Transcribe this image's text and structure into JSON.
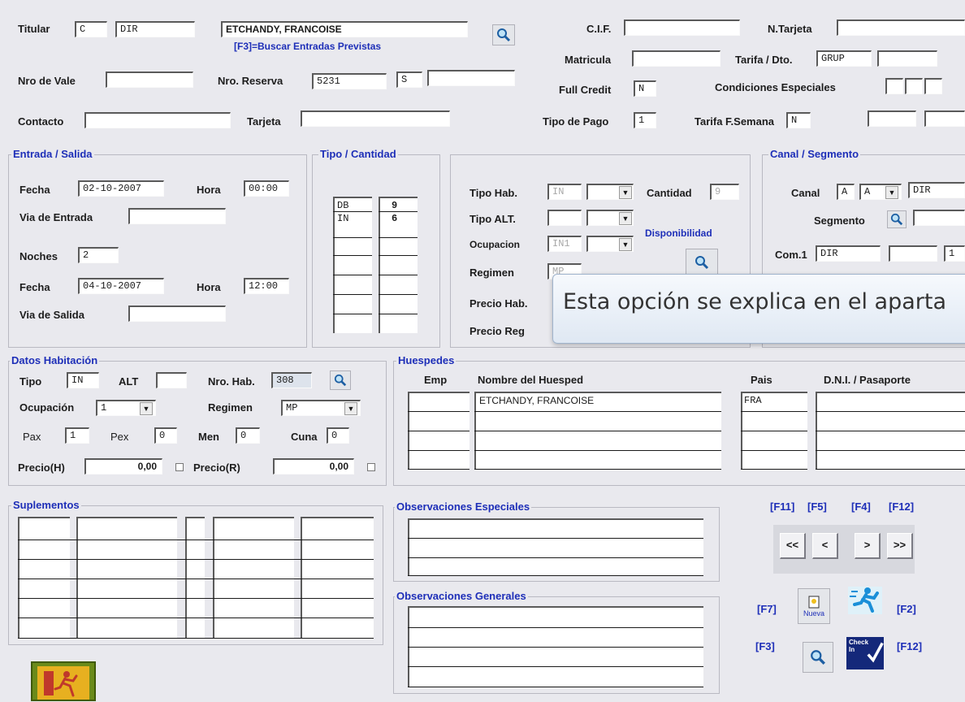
{
  "header": {
    "titular_label": "Titular",
    "titular_code": "C",
    "titular_type": "DIR",
    "titular_name": "ETCHANDY, FRANCOISE",
    "f3_hint": "[F3]=Buscar Entradas Previstas",
    "cif_label": "C.I.F.",
    "cif_value": "",
    "ntarjeta_label": "N.Tarjeta",
    "ntarjeta_value": "",
    "matricula_label": "Matricula",
    "matricula_value": "",
    "tarifa_label": "Tarifa / Dto.",
    "tarifa_value": "GRUP",
    "tarifa_dto": "",
    "nro_vale_label": "Nro de Vale",
    "nro_vale_value": "",
    "nro_reserva_label": "Nro. Reserva",
    "nro_reserva_value": "5231",
    "nro_reserva_suffix": "S",
    "nro_reserva_extra": "",
    "full_credit_label": "Full Credit",
    "full_credit_value": "N",
    "condiciones_label": "Condiciones Especiales",
    "contacto_label": "Contacto",
    "contacto_value": "",
    "tarjeta_label": "Tarjeta",
    "tarjeta_value": "",
    "tipo_pago_label": "Tipo de Pago",
    "tipo_pago_value": "1",
    "tarifa_fsemana_label": "Tarifa F.Semana",
    "tarifa_fsemana_value": "N"
  },
  "entrada_salida": {
    "title": "Entrada / Salida",
    "fecha_label": "Fecha",
    "fecha_entrada": "02-10-2007",
    "hora_label": "Hora",
    "hora_entrada": "00:00",
    "via_entrada_label": "Via de Entrada",
    "via_entrada_value": "",
    "noches_label": "Noches",
    "noches_value": "2",
    "fecha_salida": "04-10-2007",
    "hora_salida": "12:00",
    "via_salida_label": "Via de Salida",
    "via_salida_value": ""
  },
  "tipo_cantidad": {
    "title": "Tipo / Cantidad",
    "rows": [
      {
        "tipo": "DB",
        "cantidad": "9"
      },
      {
        "tipo": "IN",
        "cantidad": "6"
      }
    ]
  },
  "habitacion_tipo": {
    "tipo_hab_label": "Tipo Hab.",
    "tipo_hab_value": "IN",
    "cantidad_label": "Cantidad",
    "cantidad_value": "9",
    "tipo_alt_label": "Tipo ALT.",
    "ocupacion_label": "Ocupacion",
    "ocupacion_value": "IN1",
    "regimen_label": "Regimen",
    "regimen_value": "MP",
    "precio_hab_label": "Precio Hab.",
    "precio_reg_label": "Precio Reg",
    "disponibilidad_label": "Disponibilidad"
  },
  "canal_segmento": {
    "title": "Canal / Segmento",
    "canal_label": "Canal",
    "canal_value1": "A",
    "canal_value2": "A",
    "canal_value3": "DIR",
    "segmento_label": "Segmento",
    "com1_label": "Com.1",
    "com1_value": "DIR",
    "com1_extra": "1"
  },
  "tooltip": {
    "text": "Esta opción se explica en el aparta"
  },
  "datos_habitacion": {
    "title": "Datos Habitación",
    "tipo_label": "Tipo",
    "tipo_value": "IN",
    "alt_label": "ALT",
    "nro_hab_label": "Nro. Hab.",
    "nro_hab_value": "308",
    "ocupacion_label": "Ocupación",
    "ocupacion_value": "1",
    "regimen_label": "Regimen",
    "regimen_value": "MP",
    "pax_label": "Pax",
    "pax_value": "1",
    "pex_label": "Pex",
    "pex_value": "0",
    "men_label": "Men",
    "men_value": "0",
    "cuna_label": "Cuna",
    "cuna_value": "0",
    "precio_h_label": "Precio(H)",
    "precio_h_value": "0,00",
    "precio_r_label": "Precio(R)",
    "precio_r_value": "0,00"
  },
  "huespedes": {
    "title": "Huespedes",
    "col_emp": "Emp",
    "col_nombre": "Nombre del Huesped",
    "col_pais": "Pais",
    "col_dni": "D.N.I. / Pasaporte",
    "rows": [
      {
        "nombre": "ETCHANDY, FRANCOISE",
        "pais": "FRA"
      }
    ]
  },
  "suplementos": {
    "title": "Suplementos"
  },
  "observaciones": {
    "especiales_title": "Observaciones Especiales",
    "generales_title": "Observaciones Generales"
  },
  "navigation": {
    "key_f11": "[F11]",
    "key_f5": "[F5]",
    "key_f4": "[F4]",
    "key_f12": "[F12]",
    "first": "<<",
    "prev": "<",
    "next": ">",
    "last": ">>",
    "key_f7": "[F7]",
    "key_f2": "[F2]",
    "key_f3": "[F3]",
    "key_f12b": "[F12]",
    "nueva_label": "Nueva",
    "checkin_label": "Check In"
  }
}
